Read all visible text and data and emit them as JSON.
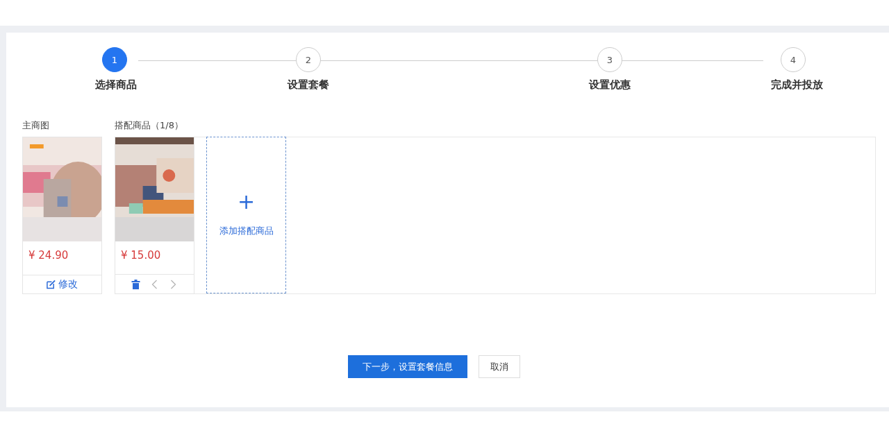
{
  "steps": [
    {
      "number": "1",
      "label": "选择商品",
      "selected": true
    },
    {
      "number": "2",
      "label": "设置套餐",
      "selected": false
    },
    {
      "number": "3",
      "label": "设置优惠",
      "selected": false
    },
    {
      "number": "4",
      "label": "完成并投放",
      "selected": false
    }
  ],
  "main_image": {
    "label": "主商图",
    "product": {
      "price": "¥ 24.90",
      "action": "修改"
    }
  },
  "bundle": {
    "label": "搭配商品（1/8）",
    "products": [
      {
        "price": "¥ 15.00"
      }
    ],
    "add_label": "添加搭配商品",
    "add_icon": "+"
  },
  "buttons": [
    {
      "label": "下一步，设置套餐信息",
      "kind": "primary"
    },
    {
      "label": "取消",
      "kind": "default"
    }
  ]
}
